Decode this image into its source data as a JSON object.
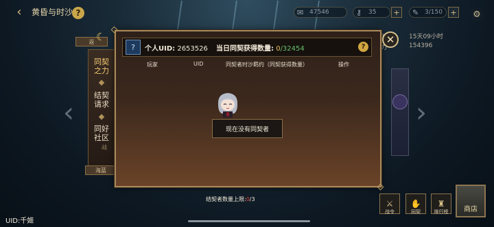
{
  "topbar": {
    "title": "黄昏与时沙",
    "help": "?",
    "resources": [
      {
        "icon": "scroll-icon",
        "value": "47546"
      },
      {
        "icon": "key-icon",
        "value": "35"
      },
      {
        "icon": "feather-icon",
        "value": "3/150"
      }
    ],
    "plus": "+"
  },
  "under": {
    "timer_label": "时",
    "timer_value": "15天09小时",
    "score_label": "力",
    "score_value": "154396"
  },
  "sidebar": {
    "pill": "返",
    "tabs": [
      {
        "label": "同契之力"
      },
      {
        "label": "结契请求"
      },
      {
        "label": "同好社区"
      }
    ],
    "battle_text": "战",
    "bottom_pill": "海蓝"
  },
  "modal": {
    "uid_label": "个人UID:",
    "uid_value": "2653526",
    "count_label": "当日同契获得数量:",
    "count_current": "0",
    "count_max": "/32454",
    "help": "?",
    "close": "✕",
    "columns": [
      "玩家",
      "UID",
      "同契者时沙羁约（同契获得数量）",
      "操作"
    ],
    "empty_text": "现在没有同契者"
  },
  "limit": {
    "label": "结契者数量上限:",
    "current": "0",
    "max": "/3"
  },
  "bottom_nav": [
    {
      "label": "战令"
    },
    {
      "label": "同契"
    },
    {
      "label": "排行榜"
    }
  ],
  "shop_label": "商店",
  "user": {
    "uid_text": "UID:千姬"
  },
  "colors": {
    "accent_gold": "#d2a742",
    "count_green": "#66c06c",
    "limit_red": "#e0443a"
  }
}
